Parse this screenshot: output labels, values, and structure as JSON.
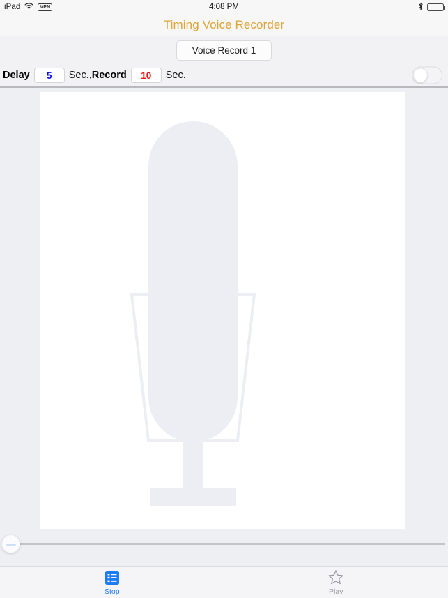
{
  "status_bar": {
    "device": "iPad",
    "wifi_icon": "wifi-icon",
    "vpn_badge": "VPN",
    "time": "4:08 PM",
    "bluetooth_icon": "bluetooth-icon",
    "battery_icon": "battery-full-icon"
  },
  "nav": {
    "title": "Timing Voice Recorder",
    "title_color": "#dfa437"
  },
  "recording": {
    "name_button": "Voice Record 1"
  },
  "controls": {
    "delay_label": "Delay",
    "delay_value": "5",
    "delay_color": "#1111ee",
    "delay_unit": "Sec.,",
    "record_label": "Record",
    "record_value": "10",
    "record_color": "#ee1111",
    "record_unit": "Sec.",
    "toggle_state": "off"
  },
  "main": {
    "artwork_icon": "microphone-icon",
    "slider_value": "0"
  },
  "tabbar": {
    "tabs": [
      {
        "label": "Stop",
        "icon": "list-icon",
        "state": "selected",
        "color": "#1e7bf0"
      },
      {
        "label": "Play",
        "icon": "star-icon",
        "state": "normal",
        "color": "#9a9a9f"
      }
    ]
  }
}
